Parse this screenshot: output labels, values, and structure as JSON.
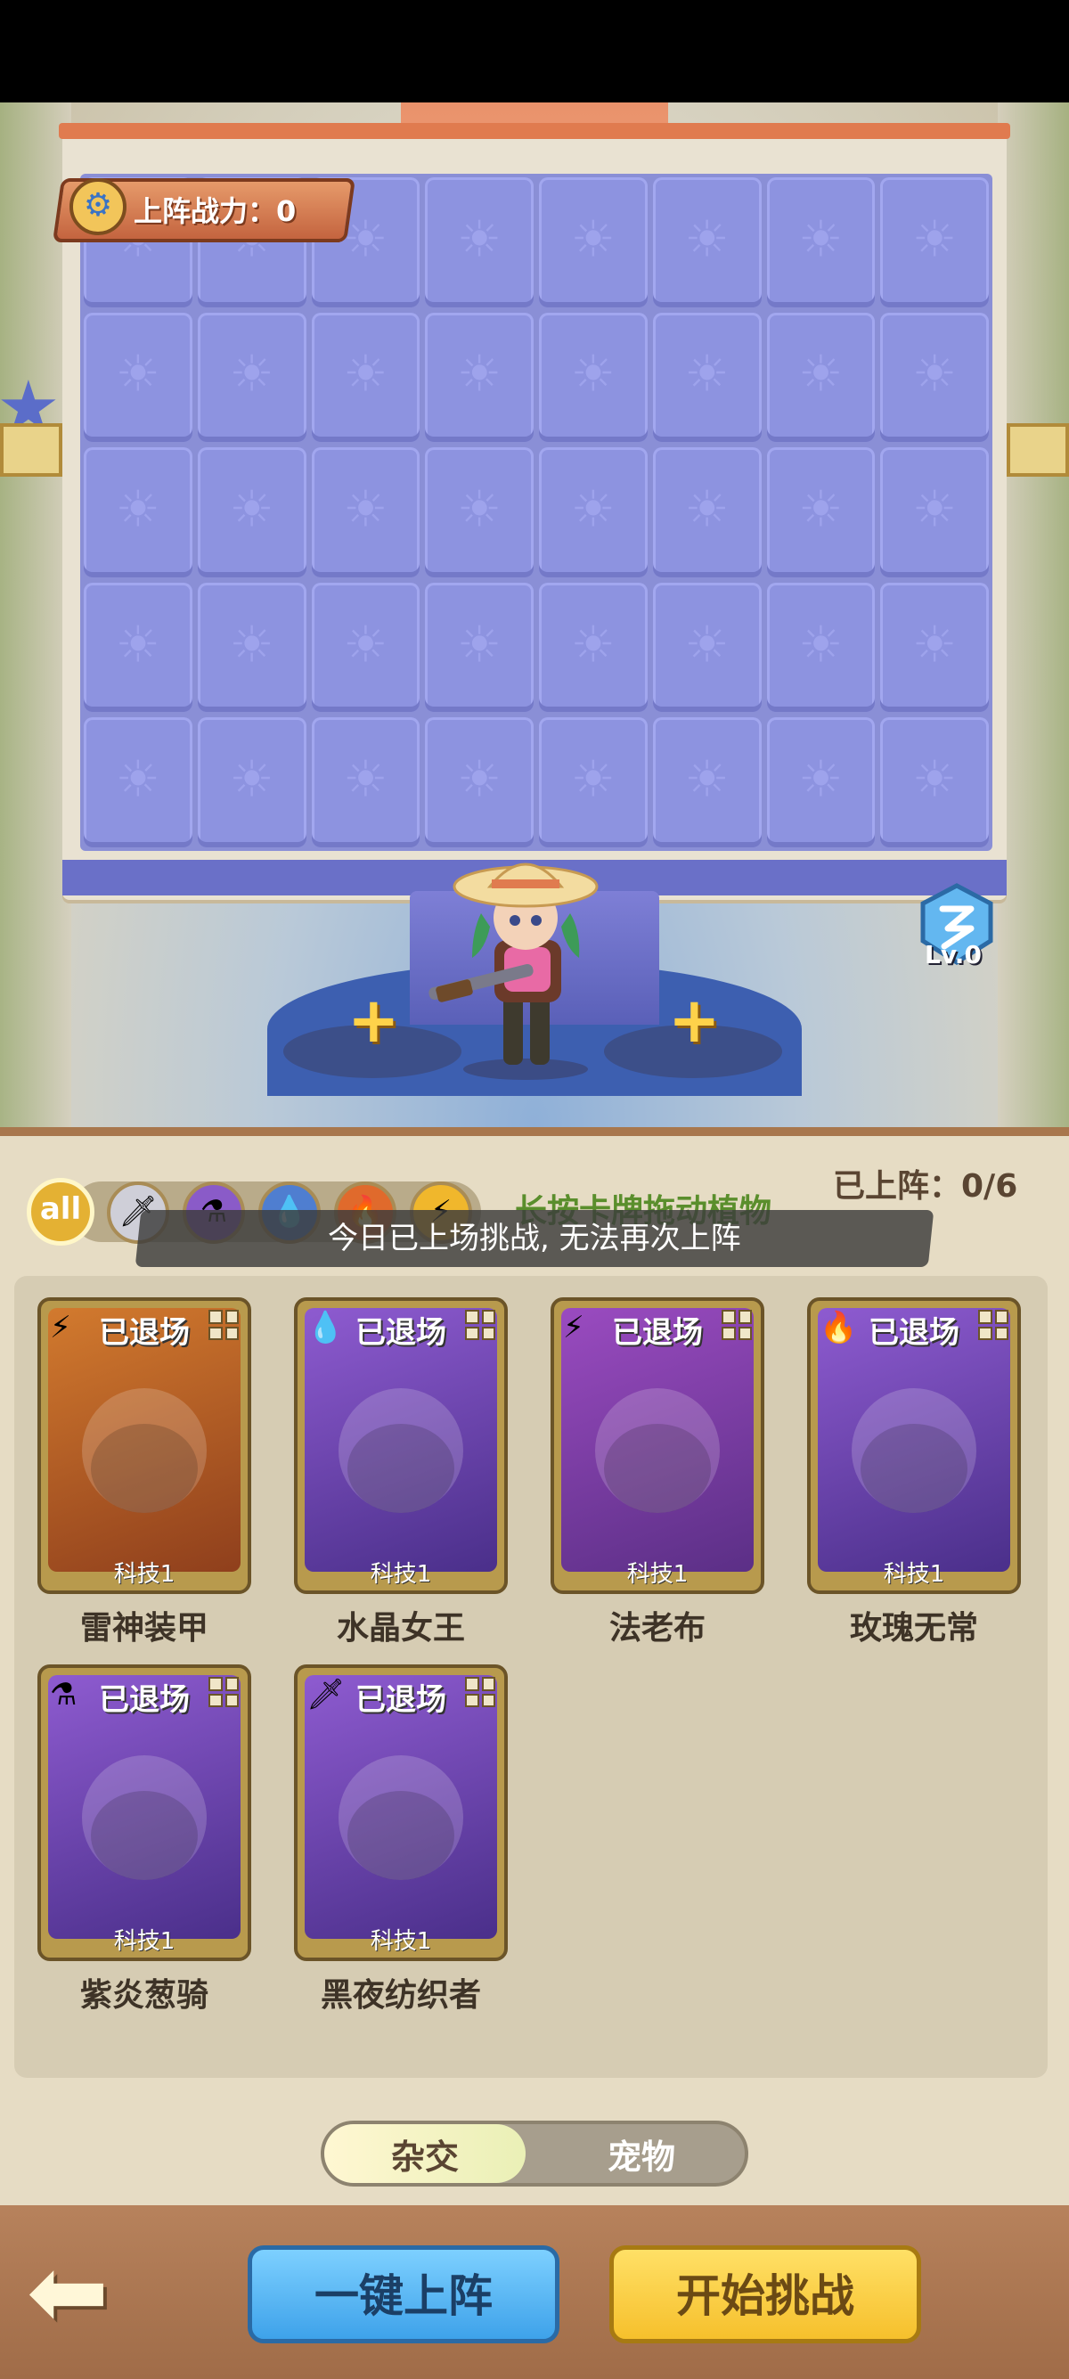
{
  "battle": {
    "power_label": "上阵战力：0",
    "level_label": "Lv.0",
    "plus_icon": "+"
  },
  "panel": {
    "filters": [
      {
        "label": "all",
        "icon": "all-icon"
      },
      {
        "icon": "melee-icon"
      },
      {
        "icon": "potion-icon"
      },
      {
        "icon": "water-icon"
      },
      {
        "icon": "fire-icon"
      },
      {
        "icon": "lightning-icon"
      }
    ],
    "hint": "长按卡牌拖动植物",
    "deployed_label": "已上阵：0/6",
    "toast": "今日已上场挑战, 无法再次上阵"
  },
  "cards": [
    {
      "status": "已退场",
      "tech": "科技1",
      "name": "雷神装甲",
      "element": "⚡"
    },
    {
      "status": "已退场",
      "tech": "科技1",
      "name": "水晶女王",
      "element": "💧"
    },
    {
      "status": "已退场",
      "tech": "科技1",
      "name": "法老布",
      "element": "⚡"
    },
    {
      "status": "已退场",
      "tech": "科技1",
      "name": "玫瑰无常",
      "element": "🔥"
    },
    {
      "status": "已退场",
      "tech": "科技1",
      "name": "紫炎葱骑",
      "element": "⚗"
    },
    {
      "status": "已退场",
      "tech": "科技1",
      "name": "黑夜纺织者",
      "element": "🗡"
    }
  ],
  "toggle": {
    "left_label": "杂交",
    "right_label": "宠物",
    "selected": "杂交"
  },
  "bottom": {
    "back_icon": "back-arrow-icon",
    "deploy_label": "一键上阵",
    "start_label": "开始挑战"
  },
  "colors": {
    "grid_tile": "#8d93e0",
    "panel_bg": "#e6dcc4",
    "deploy_btn": "#3ea2ea",
    "start_btn": "#f6c02c",
    "card_purple": "#7a3fb0",
    "card_orange": "#c86a2c"
  }
}
